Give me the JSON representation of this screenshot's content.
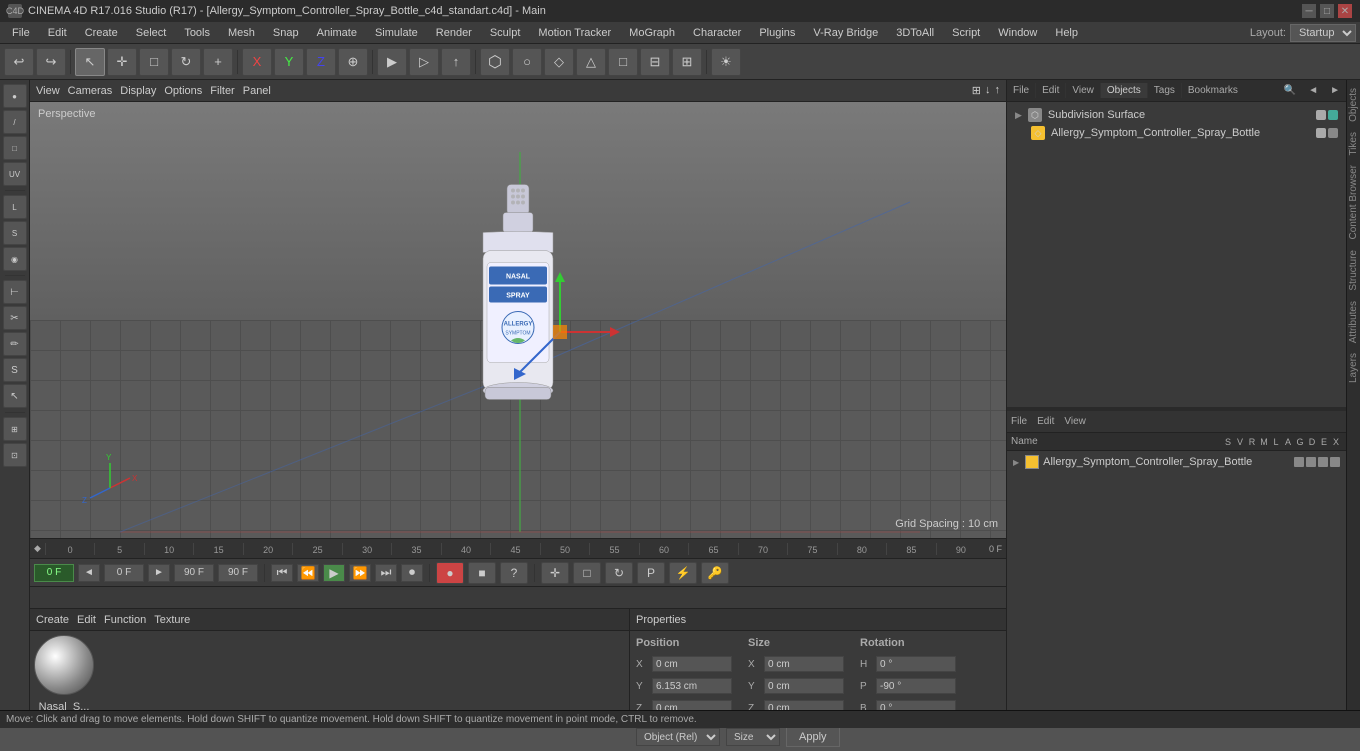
{
  "app": {
    "title": "CINEMA 4D R17.016 Studio (R17) - [Allergy_Symptom_Controller_Spray_Bottle_c4d_standart.c4d] - Main",
    "icon": "C4D"
  },
  "titlebar": {
    "controls": [
      "─",
      "□",
      "✕"
    ]
  },
  "menubar": {
    "items": [
      "File",
      "Edit",
      "Create",
      "Select",
      "Tools",
      "Mesh",
      "Snap",
      "Animate",
      "Simulate",
      "Render",
      "Sculpt",
      "Motion Tracker",
      "MoGraph",
      "Character",
      "Plugins",
      "V-Ray Bridge",
      "3DToAll",
      "Script",
      "Window",
      "Help"
    ],
    "layout_label": "Layout:",
    "layout_value": "Startup"
  },
  "toolbar": {
    "undo_label": "↩",
    "redo_label": "↪",
    "tools": [
      "↖",
      "✛",
      "□",
      "↻",
      "+",
      "X",
      "Y",
      "Z",
      "⊕",
      "▶",
      "▷",
      "↑",
      "⬡",
      "○",
      "◇",
      "△",
      "□",
      "⊟",
      "⊞",
      "☀"
    ]
  },
  "viewport": {
    "menu": [
      "View",
      "Cameras",
      "Display",
      "Options",
      "Filter",
      "Panel"
    ],
    "perspective_label": "Perspective",
    "grid_spacing": "Grid Spacing : 10 cm"
  },
  "timeline": {
    "marks": [
      "0",
      "5",
      "10",
      "15",
      "20",
      "25",
      "30",
      "35",
      "40",
      "45",
      "50",
      "55",
      "60",
      "65",
      "70",
      "75",
      "80",
      "85",
      "90"
    ],
    "current_frame": "0 F",
    "start_frame": "0 F",
    "end_frame": "90 F",
    "end_frame2": "90 F",
    "f_indicator": "0 F"
  },
  "objects_panel": {
    "toolbar": [
      "File",
      "Edit",
      "View",
      "Objects",
      "Tags",
      "Bookmarks"
    ],
    "items": [
      {
        "name": "Subdivision Surface",
        "icon": "⬡",
        "indent": 0,
        "color": "#aaa",
        "selected": false
      },
      {
        "name": "Allergy_Symptom_Controller_Spray_Bottle",
        "icon": "◇",
        "indent": 1,
        "color": "#f5c030",
        "selected": false
      }
    ]
  },
  "materials_panel": {
    "toolbar": [
      "File",
      "Edit",
      "View"
    ],
    "items": [
      {
        "name": "Allergy_Symptom_Controller_Spray_Bottle",
        "color": "#f5c030"
      }
    ],
    "columns": [
      "Name",
      "S",
      "V",
      "R",
      "M",
      "L",
      "A",
      "G",
      "D",
      "E",
      "X"
    ]
  },
  "bottom_panel": {
    "mat_header": [
      "Create",
      "Edit",
      "Function",
      "Texture"
    ],
    "mat_name": "Nasal_S...",
    "props": {
      "position_label": "Position",
      "size_label": "Size",
      "rotation_label": "Rotation",
      "pos_x": "0 cm",
      "pos_y": "6.153 cm",
      "pos_z": "0 cm",
      "size_x": "0 cm",
      "size_y": "0 cm",
      "size_z": "0 cm",
      "rot_h": "0 °",
      "rot_p": "-90 °",
      "rot_b": "0 °",
      "mode1": "Object (Rel)",
      "mode2": "Size",
      "apply_label": "Apply"
    }
  },
  "status_bar": {
    "text": "Move: Click and drag to move elements. Hold down SHIFT to quantize movement. Hold down SHIFT to quantize movement in point mode, CTRL to remove."
  },
  "right_tabs": [
    "Objects",
    "Tikes",
    "Content Browser",
    "Structure",
    "Attributes",
    "Layers"
  ],
  "anim_controls": {
    "record": "●",
    "stop": "■",
    "question": "?",
    "move": "✛",
    "rotate": "□",
    "scale": "↻",
    "param": "P",
    "auto": "⚡",
    "key": "🔑"
  }
}
